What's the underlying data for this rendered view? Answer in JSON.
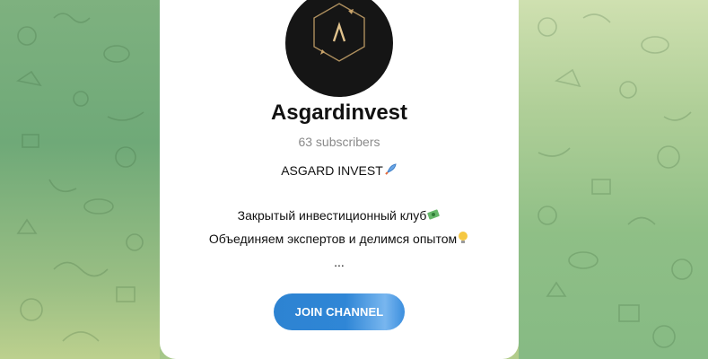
{
  "channel": {
    "name": "Asgardinvest",
    "subscribers": "63 subscribers",
    "avatar_icon": "asgard-logo-icon",
    "description": {
      "line1": "ASGARD INVEST",
      "line1_emoji": "rocket-emoji",
      "line2": "Закрытый инвестиционный клуб",
      "line2_emoji": "money-emoji",
      "line3": "Объединяем экспертов и делимся опытом",
      "line3_emoji": "lightbulb-emoji",
      "line4": "..."
    }
  },
  "actions": {
    "join_label": "JOIN CHANNEL"
  },
  "colors": {
    "accent": "#2f86d6",
    "avatar_bg": "#151515",
    "logo_gold": "#c9a46b"
  }
}
